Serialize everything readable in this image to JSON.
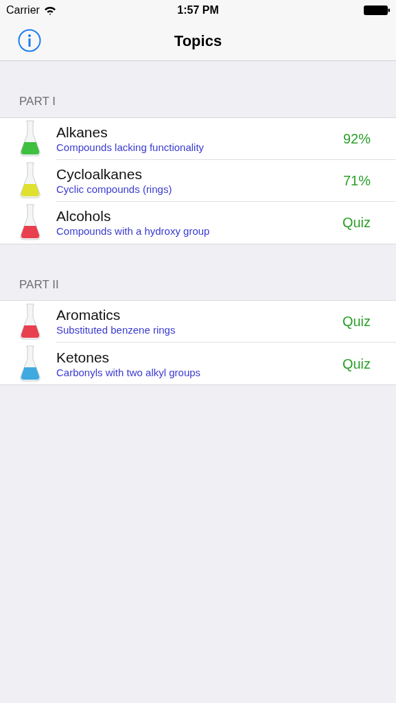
{
  "status_bar": {
    "carrier": "Carrier",
    "time": "1:57 PM"
  },
  "nav_bar": {
    "title": "Topics"
  },
  "sections": [
    {
      "header": "PART I",
      "rows": [
        {
          "title": "Alkanes",
          "subtitle": "Compounds lacking functionality",
          "detail": "92%",
          "color": "#3fbf3f"
        },
        {
          "title": "Cycloalkanes",
          "subtitle": "Cyclic compounds (rings)",
          "detail": "71%",
          "color": "#e0e030"
        },
        {
          "title": "Alcohols",
          "subtitle": "Compounds with a hydroxy group",
          "detail": "Quiz",
          "color": "#e8404f"
        }
      ]
    },
    {
      "header": "PART II",
      "rows": [
        {
          "title": "Aromatics",
          "subtitle": "Substituted benzene rings",
          "detail": "Quiz",
          "color": "#e8404f"
        },
        {
          "title": "Ketones",
          "subtitle": "Carbonyls with two alkyl groups",
          "detail": "Quiz",
          "color": "#3fa9e0"
        }
      ]
    }
  ]
}
